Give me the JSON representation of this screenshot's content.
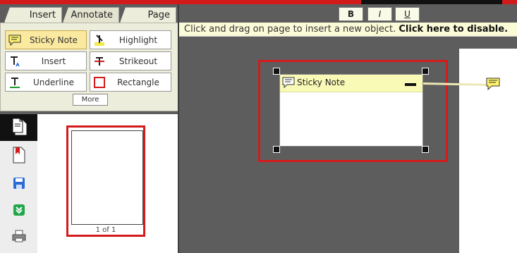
{
  "tabs": [
    {
      "label": "Insert"
    },
    {
      "label": "Annotate"
    },
    {
      "label": "Page"
    }
  ],
  "tools": [
    {
      "label": "Sticky Note",
      "icon": "sticky-note-icon",
      "active": true
    },
    {
      "label": "Highlight",
      "icon": "highlight-icon"
    },
    {
      "label": "Insert",
      "icon": "insert-text-icon"
    },
    {
      "label": "Strikeout",
      "icon": "strikeout-icon"
    },
    {
      "label": "Underline",
      "icon": "underline-icon"
    },
    {
      "label": "Rectangle",
      "icon": "rectangle-icon"
    }
  ],
  "more_label": "More",
  "format": {
    "bold": "B",
    "italic": "I",
    "underline": "U"
  },
  "notice": {
    "text": "Click and drag on page to insert a new object.",
    "link": "Click here to disable."
  },
  "thumbnail": {
    "label": "1 of 1"
  },
  "note": {
    "title": "Sticky Note"
  },
  "side_icons": [
    "pages-icon",
    "bookmark-page-icon",
    "save-icon",
    "download-icon",
    "print-icon"
  ],
  "colors": {
    "accent_red": "#d41b1b",
    "note_yellow": "#fafab7",
    "active_tool": "#fbe9a0",
    "panel_bg": "#ededdc"
  }
}
